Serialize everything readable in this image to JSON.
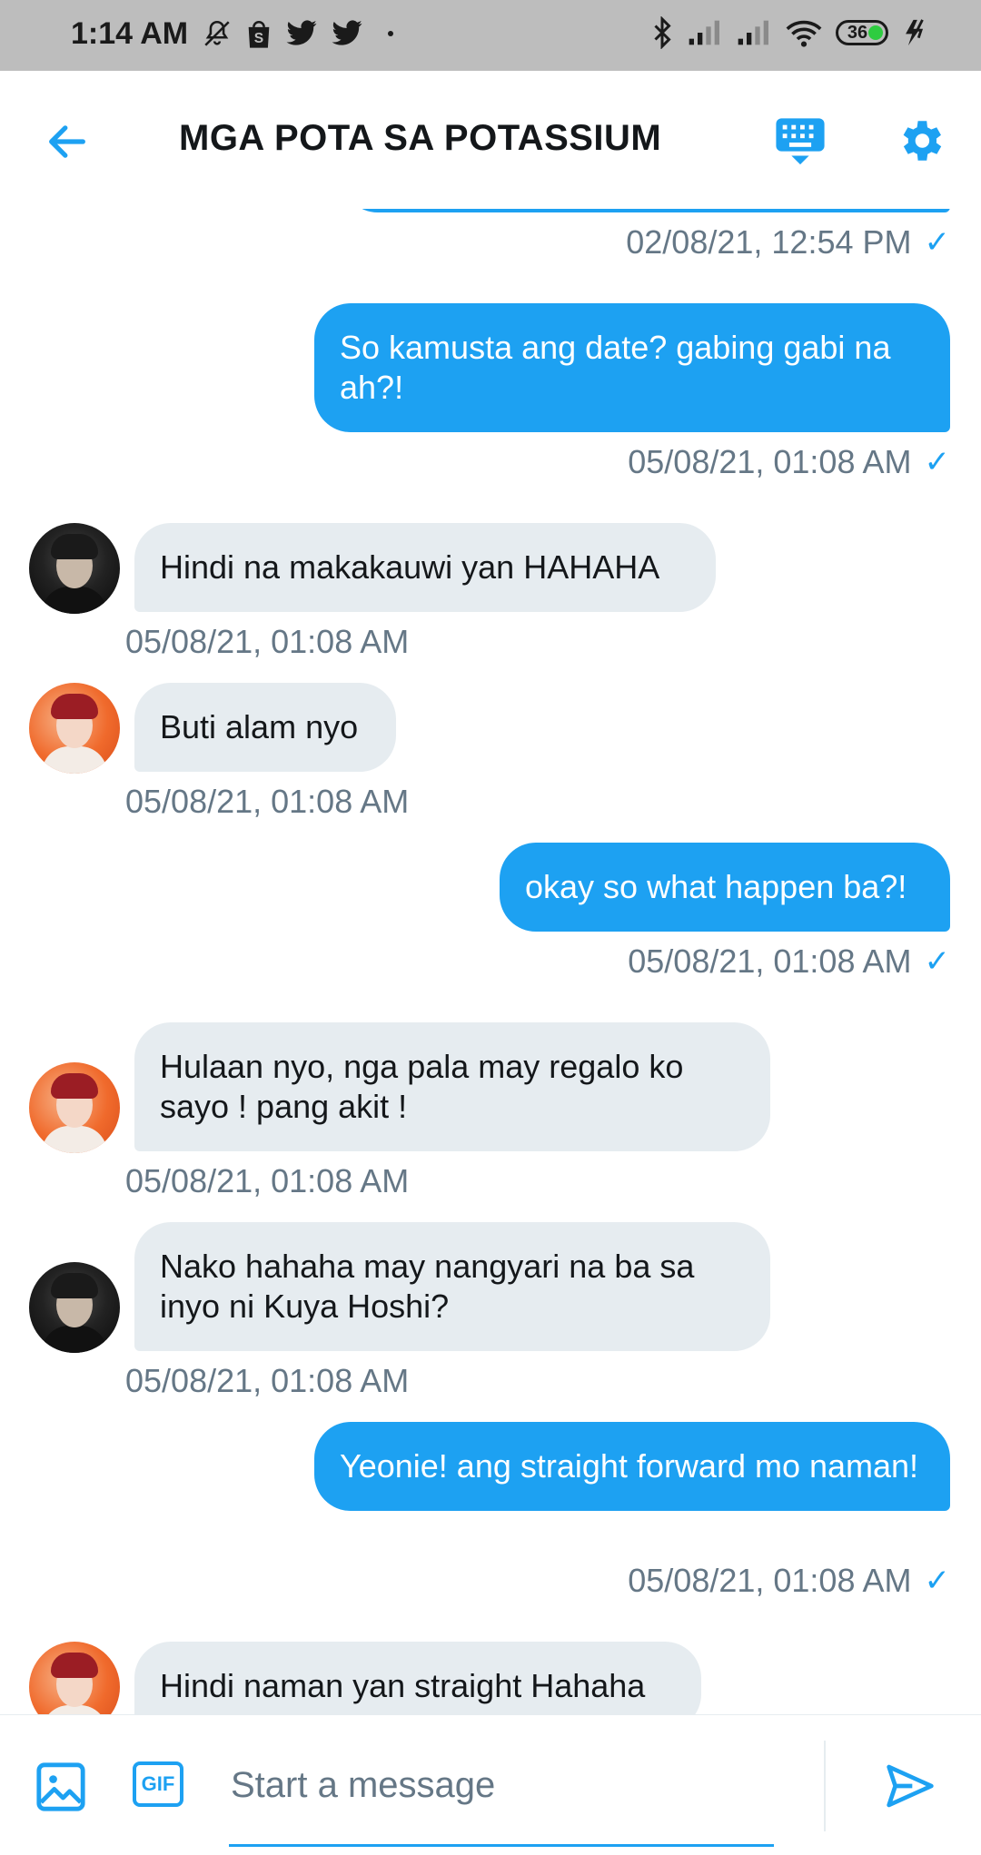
{
  "status_bar": {
    "time": "1:14 AM",
    "battery": "36",
    "left_icons": [
      "mute-bell-icon",
      "shopee-icon",
      "twitter-icon",
      "twitter-icon",
      "dot-icon"
    ],
    "right_icons": [
      "bluetooth-icon",
      "signal-icon",
      "signal-icon",
      "wifi-icon",
      "battery-icon",
      "charging-icon"
    ]
  },
  "header": {
    "title": "MGA POTA SA POTASSIUM",
    "back_icon": "arrow-left-icon",
    "keyboard_icon": "keyboard-icon",
    "settings_icon": "gear-icon"
  },
  "messages": [
    {
      "dir": "out",
      "text": "",
      "time": "02/08/21, 12:54 PM",
      "partial": true
    },
    {
      "dir": "out",
      "text": "So kamusta ang date? gabing gabi na ah?!",
      "time": "05/08/21, 01:08 AM"
    },
    {
      "dir": "in",
      "avatar": "dark",
      "text": "Hindi na makakauwi yan HAHAHA",
      "time": "05/08/21, 01:08 AM"
    },
    {
      "dir": "in",
      "avatar": "orange",
      "text": "Buti alam nyo",
      "time": "05/08/21, 01:08 AM"
    },
    {
      "dir": "out",
      "text": "okay so what happen ba?!",
      "time": "05/08/21, 01:08 AM"
    },
    {
      "dir": "in",
      "avatar": "orange",
      "text": "Hulaan nyo, nga pala may regalo ko sayo ! pang akit !",
      "time": "05/08/21, 01:08 AM"
    },
    {
      "dir": "in",
      "avatar": "dark",
      "text": "Nako hahaha may nangyari na ba sa inyo ni Kuya Hoshi?",
      "time": "05/08/21, 01:08 AM"
    },
    {
      "dir": "out",
      "text": "Yeonie! ang straight forward mo naman!",
      "time": "05/08/21, 01:08 AM"
    },
    {
      "dir": "in",
      "avatar": "orange",
      "text": "Hindi naman yan straight Hahaha",
      "time": ""
    }
  ],
  "composer": {
    "placeholder": "Start a message",
    "gif_label": "GIF",
    "image_icon": "image-icon",
    "send_icon": "send-icon"
  },
  "colors": {
    "accent": "#1da1f2",
    "bubble_in": "#e6ecf0",
    "timestamp": "#657786",
    "status_bar": "#bdbdbd"
  }
}
